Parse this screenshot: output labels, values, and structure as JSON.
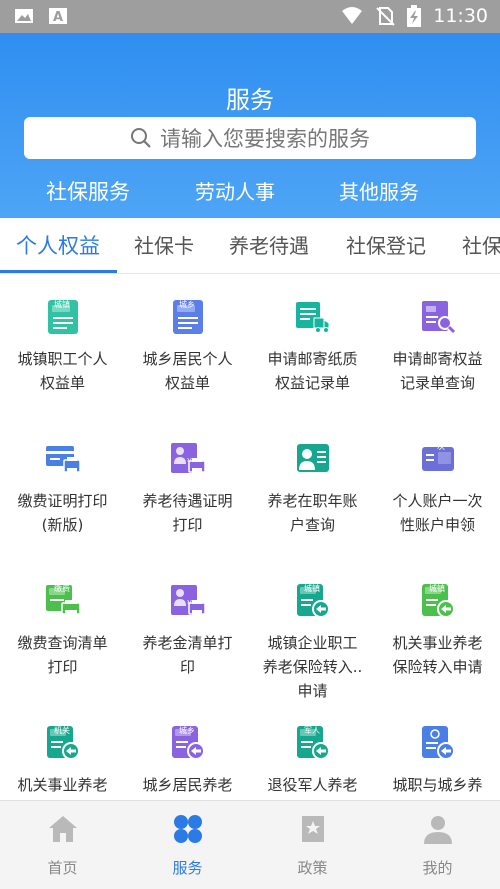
{
  "status_bar": {
    "time": "11:30"
  },
  "header": {
    "title": "服务",
    "search_placeholder": "请输入您要搜索的服务",
    "categories": [
      {
        "label": "社保服务",
        "active": true
      },
      {
        "label": "劳动人事",
        "active": false
      },
      {
        "label": "其他服务",
        "active": false
      }
    ]
  },
  "subtabs": [
    {
      "label": "个人权益",
      "active": true
    },
    {
      "label": "社保卡"
    },
    {
      "label": "养老待遇"
    },
    {
      "label": "社保登记"
    },
    {
      "label": "社保"
    }
  ],
  "grid": [
    {
      "lines": [
        "城镇职工个人",
        "权益单"
      ],
      "icon": "doc-badge-icon",
      "color": "#2fc3a3",
      "badge": "城镇"
    },
    {
      "lines": [
        "城乡居民个人",
        "权益单"
      ],
      "icon": "doc-badge-icon",
      "color": "#5b7ee8",
      "badge": "城乡"
    },
    {
      "lines": [
        "申请邮寄纸质",
        "权益记录单"
      ],
      "icon": "mail-truck-icon",
      "color": "#16b5a0"
    },
    {
      "lines": [
        "申请邮寄权益",
        "记录单查询"
      ],
      "icon": "mail-search-icon",
      "color": "#8a63e0"
    },
    {
      "lines": [
        "缴费证明打印",
        "(新版)"
      ],
      "icon": "card-printer-icon",
      "color": "#4a7fe6"
    },
    {
      "lines": [
        "养老待遇证明",
        "打印"
      ],
      "icon": "pension-printer-icon",
      "color": "#8a63e0"
    },
    {
      "lines": [
        "养老在职年账",
        "户查询"
      ],
      "icon": "person-card-icon",
      "color": "#16a88f"
    },
    {
      "lines": [
        "个人账户一次",
        "性账户申领"
      ],
      "icon": "once-card-icon",
      "color": "#6b6fd8",
      "badge": "一次"
    },
    {
      "lines": [
        "缴费查询清单",
        "打印"
      ],
      "icon": "payment-printer-icon",
      "color": "#4cc04c",
      "badge": "缴费"
    },
    {
      "lines": [
        "养老金清单打",
        "印"
      ],
      "icon": "pension-printer-icon",
      "color": "#8a63e0"
    },
    {
      "lines": [
        "城镇企业职工",
        "养老保险转入..",
        "申请"
      ],
      "icon": "transfer-in-icon",
      "color": "#16a88f",
      "badge": "城镇"
    },
    {
      "lines": [
        "机关事业养老",
        "保险转入申请"
      ],
      "icon": "transfer-in-icon",
      "color": "#4cc04c",
      "badge": "城镇"
    },
    {
      "lines": [
        "机关事业养老"
      ],
      "icon": "transfer-in-icon",
      "color": "#16a88f",
      "badge": "机关"
    },
    {
      "lines": [
        "城乡居民养老"
      ],
      "icon": "transfer-in-icon",
      "color": "#8a63e0",
      "badge": "城乡"
    },
    {
      "lines": [
        "退役军人养老"
      ],
      "icon": "transfer-in-icon",
      "color": "#16a88f",
      "badge": "军人"
    },
    {
      "lines": [
        "城职与城乡养"
      ],
      "icon": "transfer-cycle-icon",
      "color": "#4a7fe6"
    }
  ],
  "bottom_nav": [
    {
      "label": "首页",
      "icon": "home-icon",
      "active": false
    },
    {
      "label": "服务",
      "icon": "services-icon",
      "active": true
    },
    {
      "label": "政策",
      "icon": "policy-icon",
      "active": false
    },
    {
      "label": "我的",
      "icon": "profile-icon",
      "active": false
    }
  ],
  "colors": {
    "accent": "#2b7be4",
    "header_top": "#2f8ef0",
    "header_bottom": "#4ea5f6"
  }
}
